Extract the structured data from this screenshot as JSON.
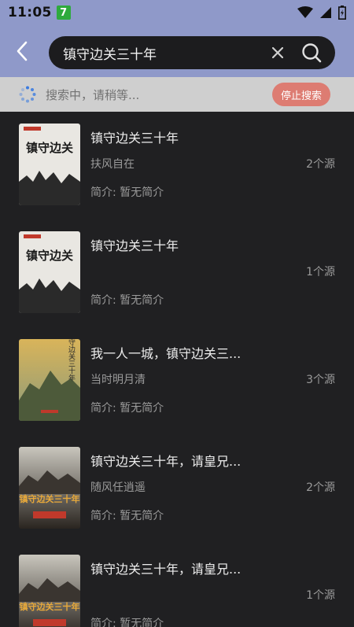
{
  "status": {
    "time": "11:05",
    "badge": "7"
  },
  "search": {
    "query": "镇守边关三十年"
  },
  "searching": {
    "text": "搜索中，请稍等...",
    "stop_label": "停止搜索"
  },
  "results": [
    {
      "title": "镇守边关三十年",
      "author": "扶风自在",
      "sources": "2个源",
      "intro": "简介: 暂无简介",
      "cover_text": "镇守边关"
    },
    {
      "title": "镇守边关三十年",
      "author": "",
      "sources": "1个源",
      "intro": "简介: 暂无简介",
      "cover_text": "镇守边关"
    },
    {
      "title": "我一人一城，镇守边关三...",
      "author": "当时明月清",
      "sources": "3个源",
      "intro": "简介: 暂无简介",
      "cover_text": "镇守边关三十年"
    },
    {
      "title": "镇守边关三十年，请皇兄...",
      "author": "随风任逍遥",
      "sources": "2个源",
      "intro": "简介: 暂无简介",
      "cover_text": "镇守边关三十年"
    },
    {
      "title": "镇守边关三十年，请皇兄...",
      "author": "",
      "sources": "1个源",
      "intro": "简介: 暂无简介",
      "cover_text": "镇守边关三十年"
    }
  ],
  "colors": {
    "accent": "#8f99c9",
    "stop_button": "#dd7c72",
    "background": "#202022"
  }
}
